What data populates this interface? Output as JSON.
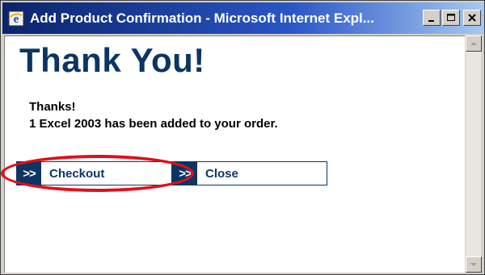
{
  "window": {
    "title": "Add Product Confirmation - Microsoft Internet Expl...",
    "buttons": [
      "minimize-icon",
      "maximize-icon",
      "close-icon"
    ]
  },
  "page": {
    "heading": "Thank You!",
    "message_line1": "Thanks!",
    "message_line2": "1 Excel 2003 has been added to your order."
  },
  "actions": {
    "arrow_glyph": ">>",
    "checkout_label": "Checkout",
    "close_label": "Close"
  },
  "colors": {
    "brand": "#0b3563",
    "highlight": "#e0101a",
    "titlebar": "#0a246a"
  }
}
